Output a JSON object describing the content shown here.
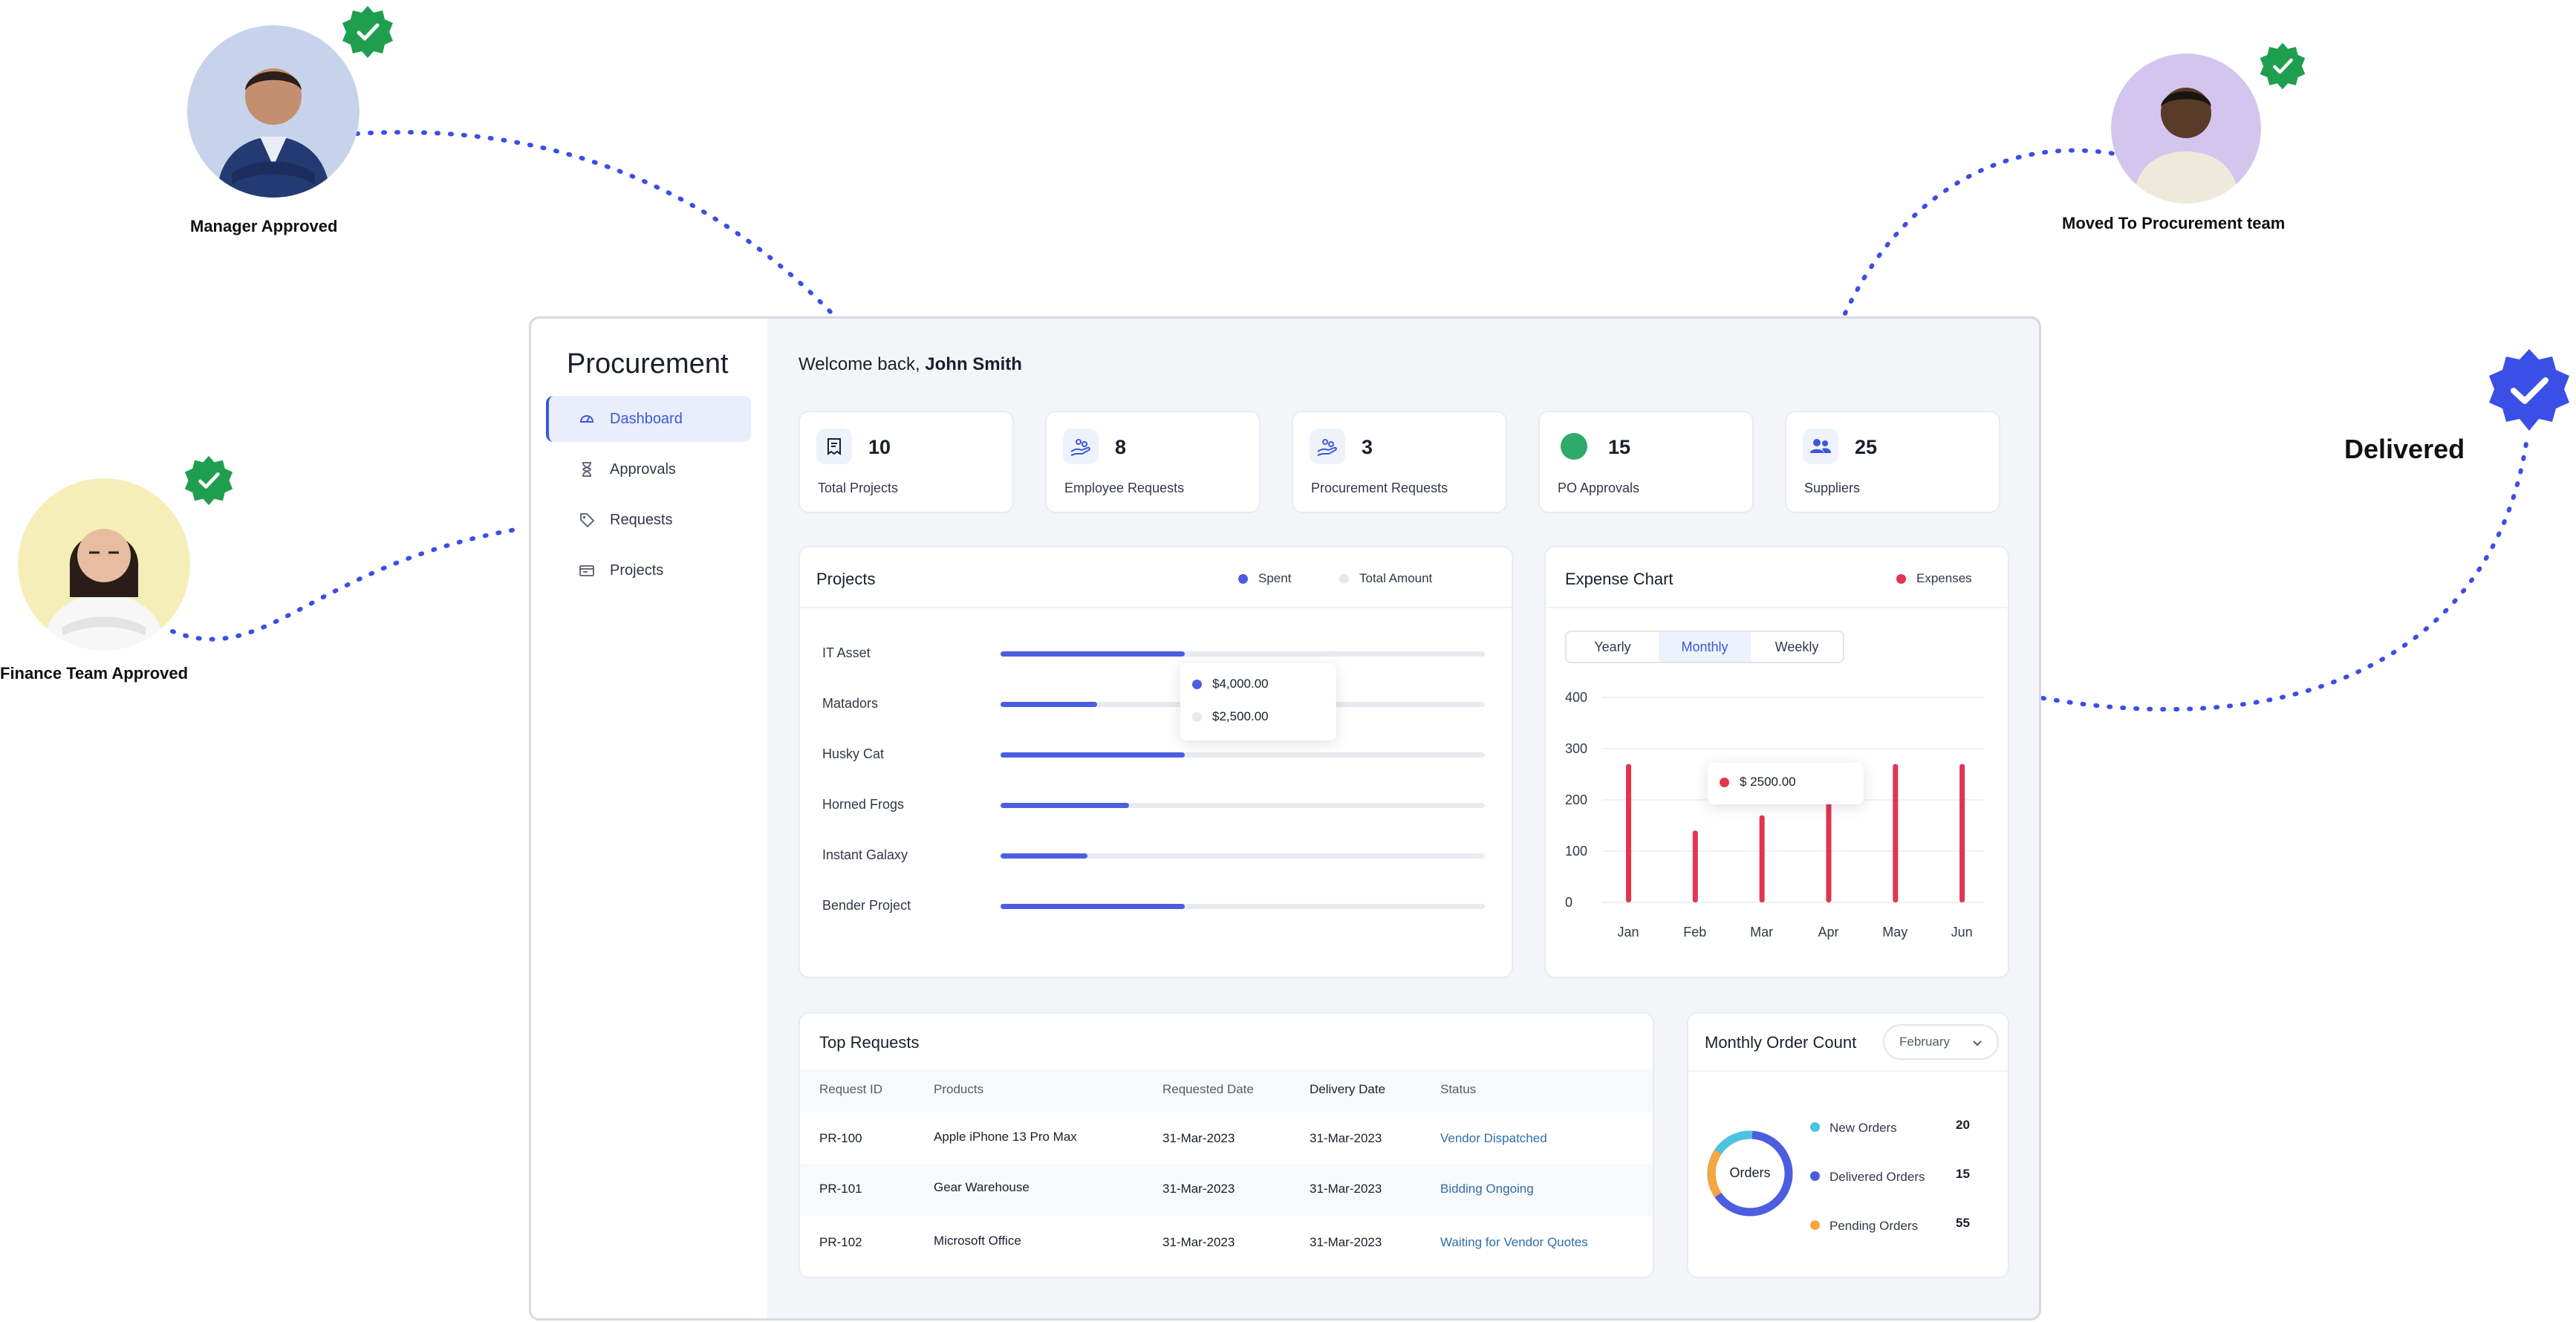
{
  "personas": {
    "manager": "Manager Approved",
    "procurement": "Moved To Procurement team",
    "finance": "Finance Team Approved",
    "delivered": "Delivered"
  },
  "colors": {
    "accent": "#3d57d9",
    "bar_fill": "#4b5ee0",
    "expense": "#e0364f",
    "verified_green": "#1f9e4f",
    "delivered_badge": "#3b4ee6",
    "connector": "#3b4ee6"
  },
  "sidebar": {
    "brand": "Procurement",
    "items": [
      {
        "label": "Dashboard",
        "icon": "dashboard-icon",
        "active": true
      },
      {
        "label": "Approvals",
        "icon": "hourglass-icon",
        "active": false
      },
      {
        "label": "Requests",
        "icon": "tag-icon",
        "active": false
      },
      {
        "label": "Projects",
        "icon": "folder-icon",
        "active": false
      }
    ]
  },
  "header": {
    "welcome_prefix": "Welcome back,",
    "user_name": "John Smith"
  },
  "stats": [
    {
      "value": "10",
      "label": "Total Projects",
      "icon": "receipt-icon"
    },
    {
      "value": "8",
      "label": "Employee Requests",
      "icon": "hand-coins-icon"
    },
    {
      "value": "3",
      "label": "Procurement Requests",
      "icon": "hand-coins-icon"
    },
    {
      "value": "15",
      "label": "PO Approvals",
      "icon": "green-circle-icon"
    },
    {
      "value": "25",
      "label": "Suppliers",
      "icon": "users-icon"
    }
  ],
  "projects": {
    "title": "Projects",
    "legend_spent": "Spent",
    "legend_total": "Total Amount",
    "rows": [
      {
        "name": "IT Asset",
        "progress": 0.38
      },
      {
        "name": "Matadors",
        "progress": 0.2
      },
      {
        "name": "Husky Cat",
        "progress": 0.38
      },
      {
        "name": "Horned Frogs",
        "progress": 0.265
      },
      {
        "name": "Instant Galaxy",
        "progress": 0.18
      },
      {
        "name": "Bender Project",
        "progress": 0.38
      }
    ],
    "tooltip": {
      "spent": "$4,000.00",
      "total": "$2,500.00"
    }
  },
  "expense": {
    "title": "Expense Chart",
    "legend": "Expenses",
    "tabs": [
      {
        "label": "Yearly",
        "active": false
      },
      {
        "label": "Monthly",
        "active": true
      },
      {
        "label": "Weekly",
        "active": false
      }
    ],
    "tooltip": "$ 2500.00"
  },
  "chart_data": {
    "type": "bar",
    "title": "Expense Chart",
    "categories": [
      "Jan",
      "Feb",
      "Mar",
      "Apr",
      "May",
      "Jun"
    ],
    "series": [
      {
        "name": "Expenses",
        "values": [
          270,
          140,
          170,
          210,
          270,
          270
        ]
      }
    ],
    "yticks": [
      "400",
      "300",
      "200",
      "100",
      "0"
    ],
    "ylim": [
      0,
      400
    ],
    "legend": "top-right"
  },
  "requests": {
    "title": "Top Requests",
    "columns": [
      "Request ID",
      "Products",
      "Requested Date",
      "Delivery Date",
      "Status"
    ],
    "rows": [
      {
        "id": "PR-100",
        "product": "Apple iPhone 13 Pro Max",
        "requested": "31-Mar-2023",
        "delivery": "31-Mar-2023",
        "status": "Vendor Dispatched"
      },
      {
        "id": "PR-101",
        "product": "Gear Warehouse",
        "requested": "31-Mar-2023",
        "delivery": "31-Mar-2023",
        "status": "Bidding Ongoing"
      },
      {
        "id": "PR-102",
        "product": "Microsoft Office",
        "requested": "31-Mar-2023",
        "delivery": "31-Mar-2023",
        "status": "Waiting for Vendor Quotes"
      }
    ]
  },
  "orders": {
    "title": "Monthly Order Count",
    "month": "February",
    "center_label": "Orders",
    "items": [
      {
        "label": "New Orders",
        "count": "20",
        "color": "#4cc3e0"
      },
      {
        "label": "Delivered Orders",
        "count": "15",
        "color": "#4b5ee0"
      },
      {
        "label": "Pending Orders",
        "count": "55",
        "color": "#f5a640"
      }
    ]
  }
}
